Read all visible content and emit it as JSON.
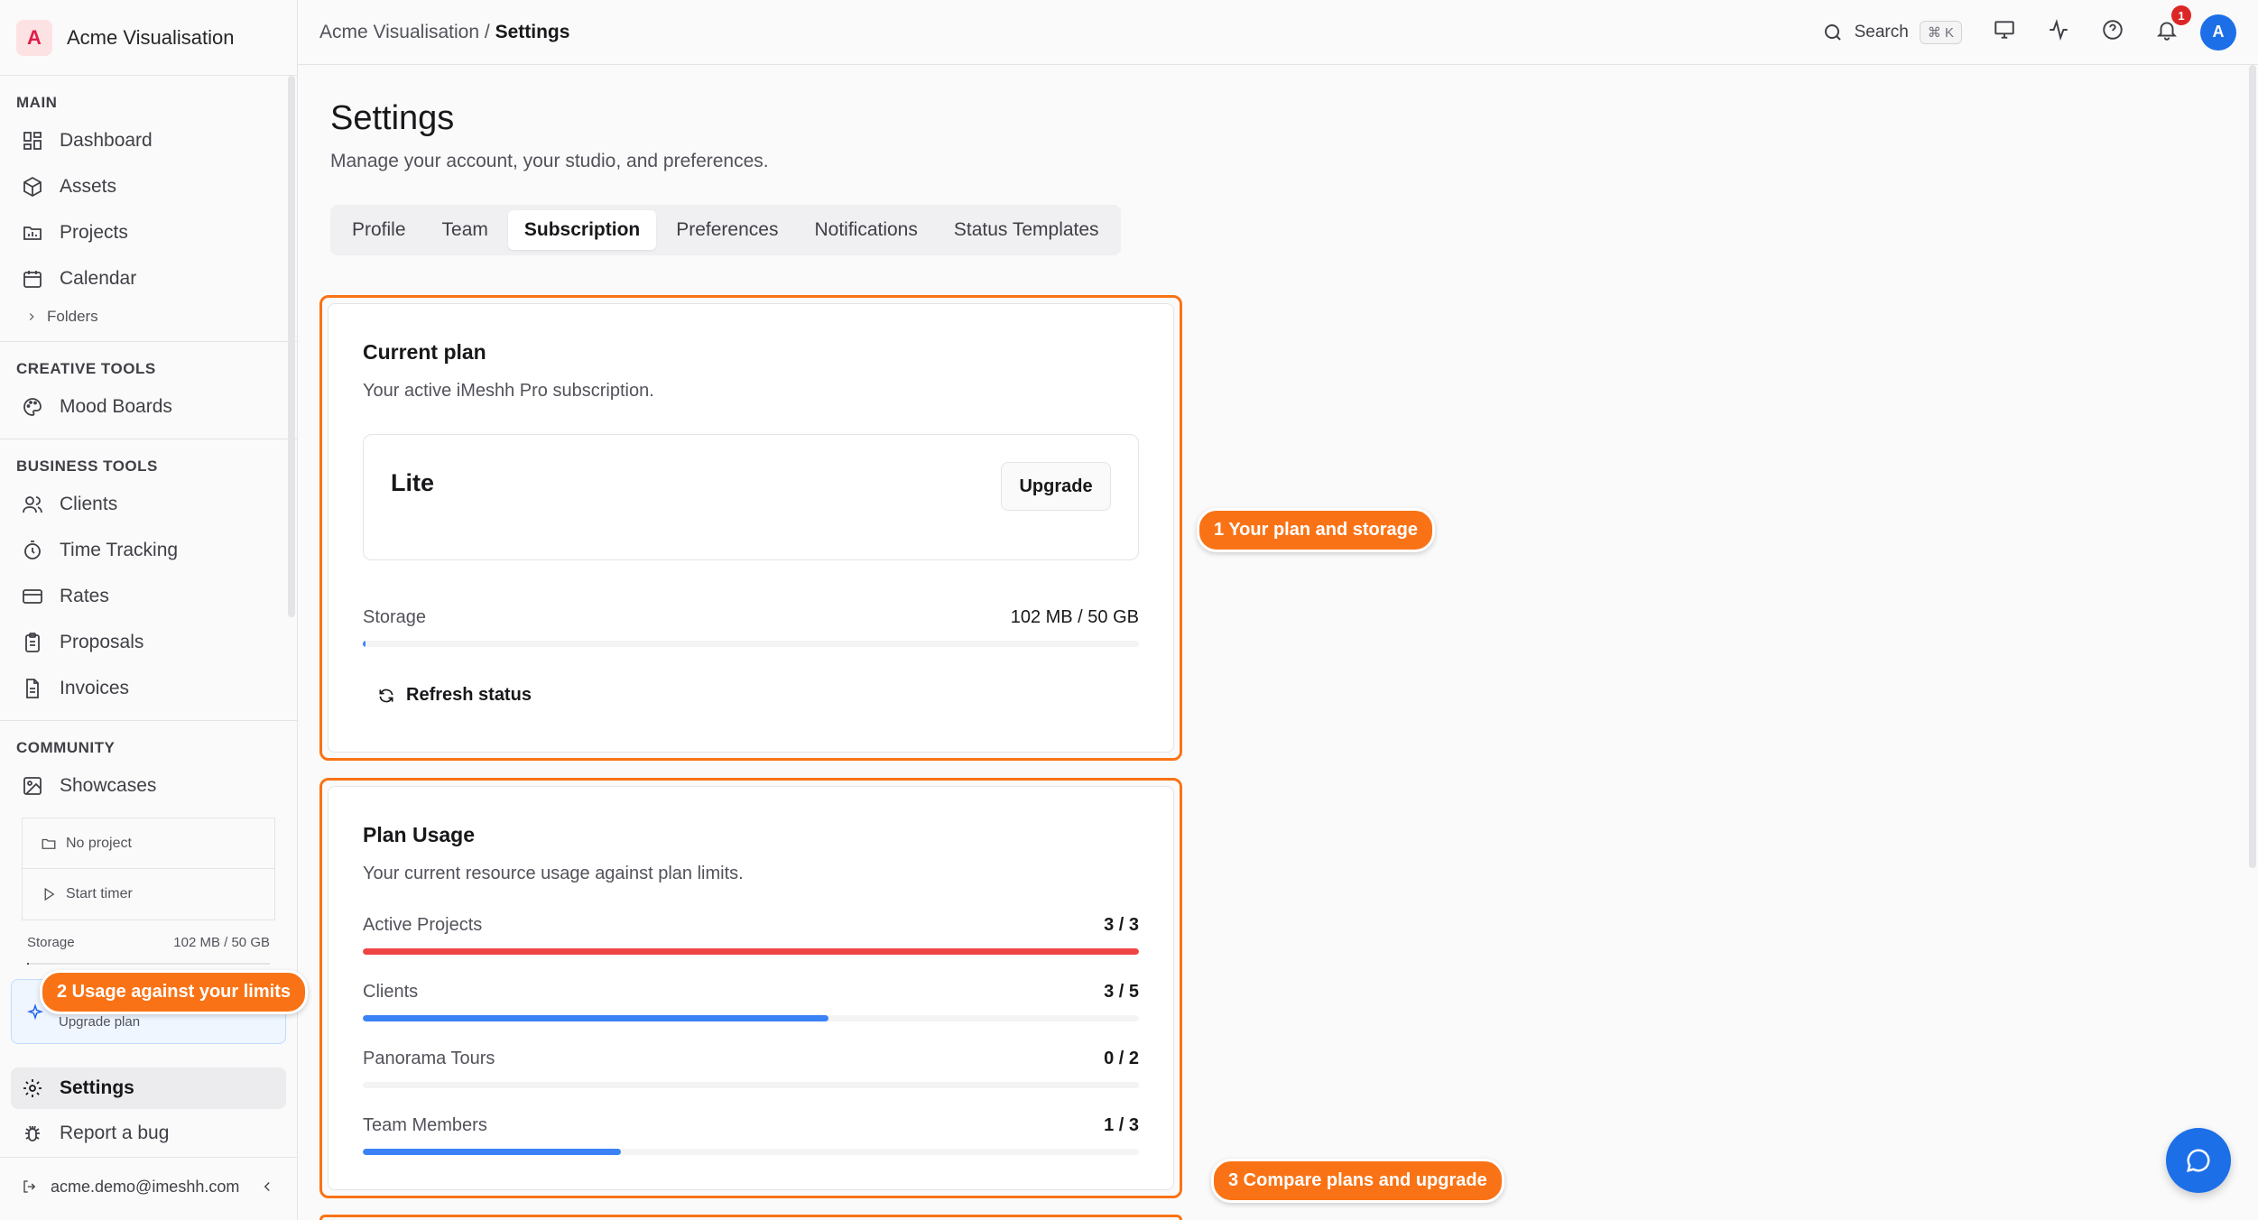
{
  "brand": {
    "logo_letter": "A",
    "name": "Acme Visualisation"
  },
  "sidebar": {
    "sections": [
      {
        "label": "MAIN",
        "items": [
          "Dashboard",
          "Assets",
          "Projects",
          "Calendar"
        ],
        "sub": "Folders"
      },
      {
        "label": "CREATIVE TOOLS",
        "items": [
          "Mood Boards"
        ]
      },
      {
        "label": "BUSINESS TOOLS",
        "items": [
          "Clients",
          "Time Tracking",
          "Rates",
          "Proposals",
          "Invoices"
        ]
      },
      {
        "label": "COMMUNITY",
        "items": [
          "Showcases"
        ]
      }
    ],
    "timer": {
      "project": "No project",
      "start": "Start timer"
    },
    "storage": {
      "label": "Storage",
      "value": "102 MB / 50 GB"
    },
    "upgrade_label": "Upgrade plan",
    "settings": "Settings",
    "report_bug": "Report a bug",
    "user_email": "acme.demo@imeshh.com"
  },
  "topbar": {
    "breadcrumb_root": "Acme Visualisation",
    "breadcrumb_sep": " / ",
    "breadcrumb_current": "Settings",
    "search_label": "Search",
    "search_kbd": "⌘ K",
    "notification_count": "1",
    "avatar_letter": "A"
  },
  "page": {
    "title": "Settings",
    "subtitle": "Manage your account, your studio, and preferences.",
    "tabs": [
      "Profile",
      "Team",
      "Subscription",
      "Preferences",
      "Notifications",
      "Status Templates"
    ],
    "active_tab": "Subscription"
  },
  "current_plan": {
    "title": "Current plan",
    "subtitle": "Your active iMeshh Pro subscription.",
    "plan_name": "Lite",
    "upgrade_button": "Upgrade",
    "storage_label": "Storage",
    "storage_value": "102 MB / 50 GB",
    "storage_fraction": 0.002,
    "refresh_label": "Refresh status"
  },
  "plan_usage": {
    "title": "Plan Usage",
    "subtitle": "Your current resource usage against plan limits.",
    "rows": [
      {
        "label": "Active Projects",
        "value": "3 / 3",
        "fraction": 1.0,
        "color": "#ef4444"
      },
      {
        "label": "Clients",
        "value": "3 / 5",
        "fraction": 0.6,
        "color": "#3b82f6"
      },
      {
        "label": "Panorama Tours",
        "value": "0 / 2",
        "fraction": 0.0,
        "color": "#3b82f6"
      },
      {
        "label": "Team Members",
        "value": "1 / 3",
        "fraction": 0.333,
        "color": "#3b82f6"
      }
    ]
  },
  "callouts": {
    "c1": "1 Your plan and storage",
    "c2": "2 Usage against your limits",
    "c3": "3 Compare plans and upgrade"
  },
  "colors": {
    "accent": "#f97316",
    "primary": "#1d6fe8",
    "danger": "#ef4444"
  }
}
